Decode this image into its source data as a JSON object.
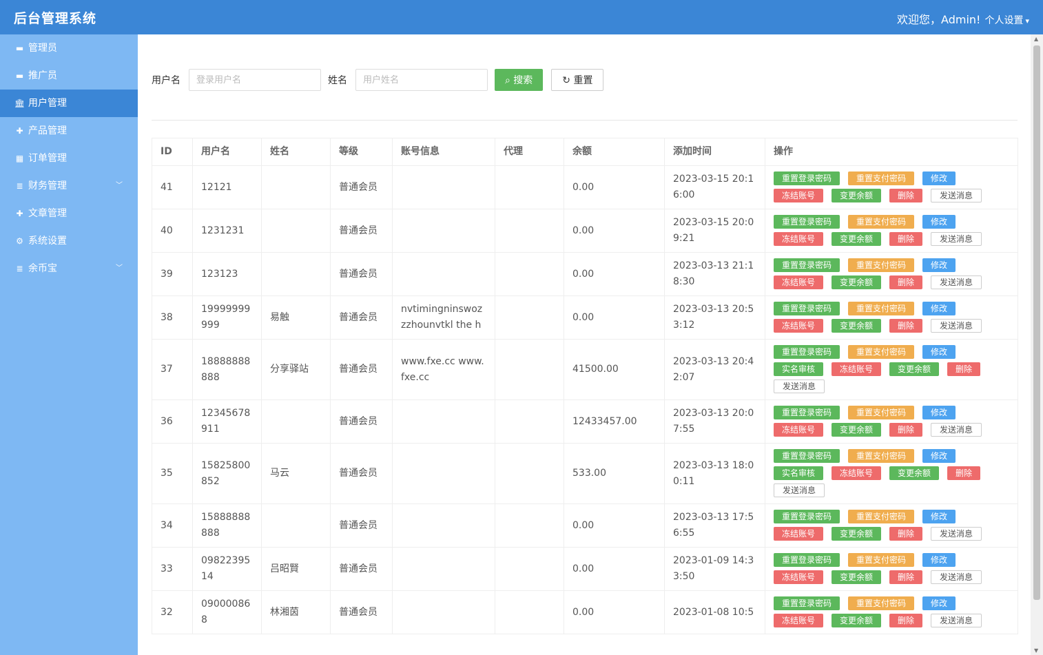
{
  "header": {
    "brand": "后台管理系统",
    "welcome": "欢迎您，Admin!",
    "settings": "个人设置"
  },
  "sidebar": {
    "items": [
      {
        "label": "管理员",
        "icon": "card-icon",
        "active": false,
        "submenu": false
      },
      {
        "label": "推广员",
        "icon": "card-icon",
        "active": false,
        "submenu": false
      },
      {
        "label": "用户管理",
        "icon": "bank-icon",
        "active": true,
        "submenu": false
      },
      {
        "label": "产品管理",
        "icon": "puzzle-icon",
        "active": false,
        "submenu": false
      },
      {
        "label": "订单管理",
        "icon": "calculator-icon",
        "active": false,
        "submenu": false
      },
      {
        "label": "财务管理",
        "icon": "database-icon",
        "active": false,
        "submenu": true
      },
      {
        "label": "文章管理",
        "icon": "puzzle-icon",
        "active": false,
        "submenu": false
      },
      {
        "label": "系统设置",
        "icon": "gear-icon",
        "active": false,
        "submenu": false
      },
      {
        "label": "余币宝",
        "icon": "database-icon",
        "active": false,
        "submenu": true
      }
    ]
  },
  "filter": {
    "username_label": "用户名",
    "username_placeholder": "登录用户名",
    "name_label": "姓名",
    "name_placeholder": "用户姓名",
    "search_label": "搜索",
    "reset_label": "重置"
  },
  "table": {
    "columns": [
      "ID",
      "用户名",
      "姓名",
      "等级",
      "账号信息",
      "代理",
      "余额",
      "添加时间",
      "操作"
    ],
    "ops_labels": {
      "reset_login": "重置登录密码",
      "reset_pay": "重置支付密码",
      "edit": "修改",
      "verify": "实名审核",
      "freeze": "冻结账号",
      "balance": "变更余额",
      "delete": "删除",
      "message": "发送消息"
    },
    "rows": [
      {
        "id": "41",
        "username": "12121",
        "name": "",
        "level": "普通会员",
        "account": "",
        "agent": "",
        "balance": "0.00",
        "time": "2023-03-15 20:16:00",
        "verify": false
      },
      {
        "id": "40",
        "username": "1231231",
        "name": "",
        "level": "普通会员",
        "account": "",
        "agent": "",
        "balance": "0.00",
        "time": "2023-03-15 20:09:21",
        "verify": false
      },
      {
        "id": "39",
        "username": "123123",
        "name": "",
        "level": "普通会员",
        "account": "",
        "agent": "",
        "balance": "0.00",
        "time": "2023-03-13 21:18:30",
        "verify": false
      },
      {
        "id": "38",
        "username": "19999999999",
        "name": "易触",
        "level": "普通会员",
        "account": "nvtimingninswozzzhounvtkl the h",
        "agent": "",
        "balance": "0.00",
        "time": "2023-03-13 20:53:12",
        "verify": false
      },
      {
        "id": "37",
        "username": "18888888888",
        "name": "分享驿站",
        "level": "普通会员",
        "account": "www.fxe.cc www.fxe.cc",
        "agent": "",
        "balance": "41500.00",
        "time": "2023-03-13 20:42:07",
        "verify": true
      },
      {
        "id": "36",
        "username": "12345678911",
        "name": "",
        "level": "普通会员",
        "account": "",
        "agent": "",
        "balance": "12433457.00",
        "time": "2023-03-13 20:07:55",
        "verify": false
      },
      {
        "id": "35",
        "username": "15825800852",
        "name": "马云",
        "level": "普通会员",
        "account": "",
        "agent": "",
        "balance": "533.00",
        "time": "2023-03-13 18:00:11",
        "verify": true
      },
      {
        "id": "34",
        "username": "15888888888",
        "name": "",
        "level": "普通会员",
        "account": "",
        "agent": "",
        "balance": "0.00",
        "time": "2023-03-13 17:56:55",
        "verify": false
      },
      {
        "id": "33",
        "username": "0982239514",
        "name": "吕昭賢",
        "level": "普通会员",
        "account": "",
        "agent": "",
        "balance": "0.00",
        "time": "2023-01-09 14:33:50",
        "verify": false
      },
      {
        "id": "32",
        "username": "090000868",
        "name": "林湘茵",
        "level": "普通会员",
        "account": "",
        "agent": "",
        "balance": "0.00",
        "time": "2023-01-08 10:5",
        "verify": false
      }
    ]
  }
}
